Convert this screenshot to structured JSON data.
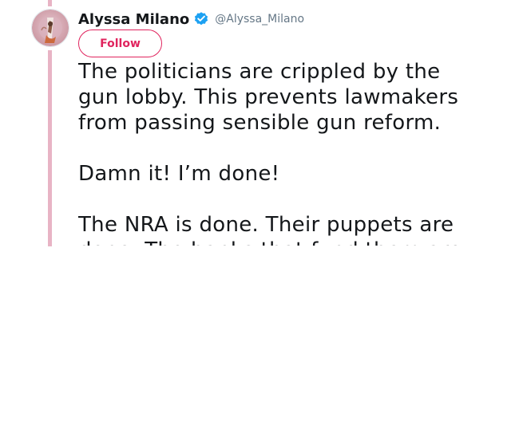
{
  "author": {
    "display_name": "Alyssa Milano",
    "handle": "@Alyssa_Milano",
    "verified": true,
    "avatar_icon": "profile-photo"
  },
  "actions": {
    "follow_label": "Follow"
  },
  "tweet": {
    "paragraphs": [
      {
        "lines": [
          "The politicians are crippled by the",
          "gun lobby. This prevents lawmakers",
          "from passing sensible gun reform."
        ]
      },
      {
        "lines": [
          "Damn it! I’m done!"
        ]
      },
      {
        "lines": [
          "The NRA is done. Their puppets are",
          "done. The banks that fund them are"
        ]
      }
    ]
  },
  "colors": {
    "thread_line": "#e8b4c5",
    "follow_accent": "#e0245e",
    "verified_badge": "#1da1f2",
    "handle_text": "#657786",
    "body_text": "#14171a"
  }
}
